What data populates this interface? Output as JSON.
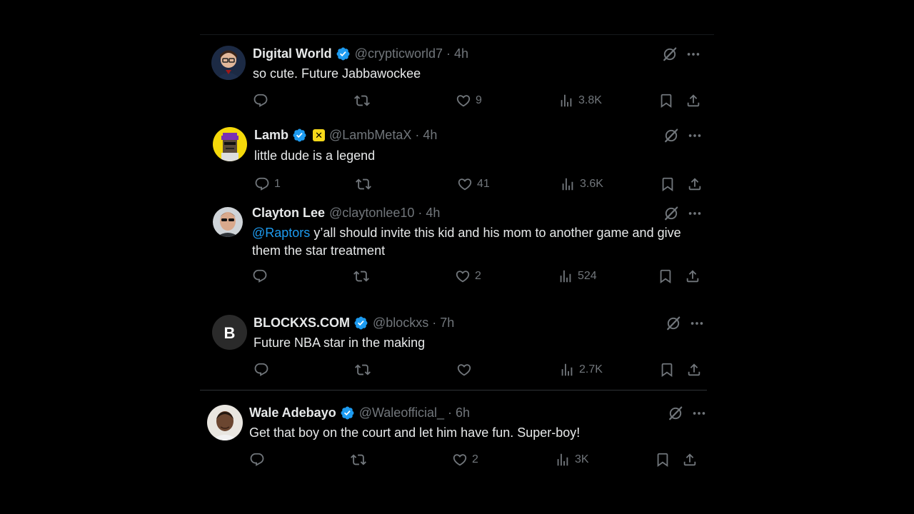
{
  "replies": [
    {
      "name": "Digital World",
      "handle": "@crypticworld7",
      "dot": "·",
      "time": "4h",
      "text": "so cute. Future Jabbawockee",
      "replies": "",
      "reposts": "",
      "likes": "9",
      "views": "3.8K"
    },
    {
      "name": "Lamb",
      "affiliate_badge": "✕",
      "handle": "@LambMetaX",
      "dot": "·",
      "time": "4h",
      "text": "little dude is a legend",
      "replies": "1",
      "reposts": "",
      "likes": "41",
      "views": "3.6K"
    },
    {
      "name": "Clayton Lee",
      "handle": "@claytonlee10",
      "dot": "·",
      "time": "4h",
      "mention": "@Raptors",
      "text": " y’all should invite this kid and his mom to another game and give them the star treatment",
      "replies": "",
      "reposts": "",
      "likes": "2",
      "views": "524"
    },
    {
      "name": "BLOCKXS.COM",
      "avatar_letter": "B",
      "handle": "@blockxs",
      "dot": "·",
      "time": "7h",
      "text": "Future NBA star in the making",
      "replies": "",
      "reposts": "",
      "likes": "",
      "views": "2.7K"
    },
    {
      "name": "Wale Adebayo",
      "handle": "@Waleofficial_",
      "dot": "·",
      "time": "6h",
      "text": "Get that boy on the court and let him have fun. Super-boy!",
      "replies": "",
      "reposts": "",
      "likes": "2",
      "views": "3K"
    }
  ],
  "colors": {
    "background": "#000000",
    "text": "#e7e9ea",
    "secondary": "#71767b",
    "accent": "#1d9bf0",
    "affiliate_badge": "#f7d91a"
  },
  "icons": [
    "verified-badge-icon",
    "grok-icon",
    "more-icon",
    "reply-icon",
    "repost-icon",
    "like-icon",
    "views-icon",
    "bookmark-icon",
    "share-icon"
  ]
}
